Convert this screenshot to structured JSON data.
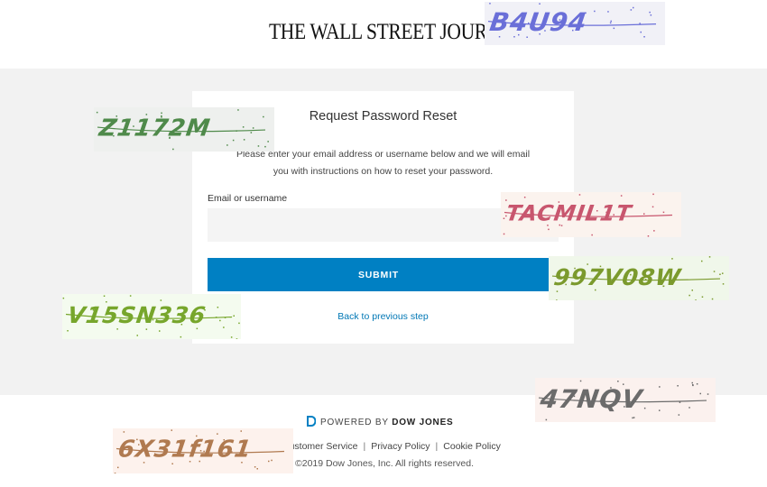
{
  "header": {
    "logo_text": "THE WALL STREET JOURNA"
  },
  "reset_form": {
    "title": "Request Password Reset",
    "description": "Please enter your email address or username below and we will email you with instructions on how to reset your password.",
    "email_label": "Email or username",
    "email_value": "",
    "submit_label": "SUBMIT",
    "back_link": "Back to previous step"
  },
  "footer": {
    "powered_by": "POWERED BY",
    "brand": "DOW JONES",
    "links": [
      "Customer Service",
      "Privacy Policy",
      "Cookie Policy"
    ],
    "copyright": "©2019 Dow Jones, Inc. All rights reserved."
  },
  "captchas": [
    {
      "text": "B4U94",
      "color": "#6a6fd8",
      "bg": "#f1f1f7"
    },
    {
      "text": "Z1172M",
      "color": "#4f8a4a",
      "bg": "#eef0ee"
    },
    {
      "text": "TACMIL1T",
      "color": "#c8566e",
      "bg": "#fbf3ee"
    },
    {
      "text": "997V08W",
      "color": "#7b9a2d",
      "bg": "#f0f7ea"
    },
    {
      "text": "V15SN336",
      "color": "#77a62c",
      "bg": "#f4fbef"
    },
    {
      "text": "47NQV",
      "color": "#6b6b6b",
      "bg": "#fbf1ee"
    },
    {
      "text": "6X31f161",
      "color": "#b07a50",
      "bg": "#fdf2ed"
    }
  ]
}
